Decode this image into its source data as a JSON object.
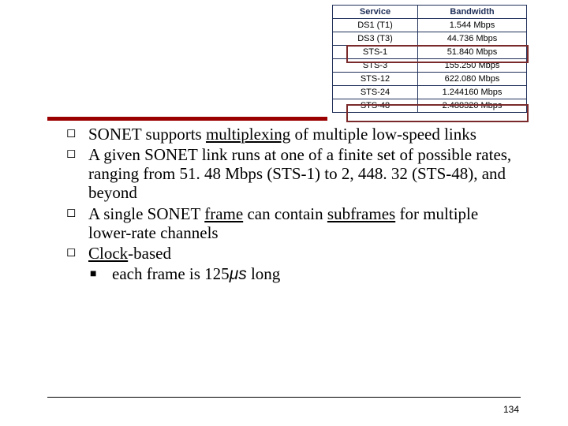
{
  "chart_data": {
    "type": "table",
    "columns": [
      "Service",
      "Bandwidth"
    ],
    "rows": [
      [
        "DS1 (T1)",
        "1.544 Mbps"
      ],
      [
        "DS3 (T3)",
        "44.736 Mbps"
      ],
      [
        "STS-1",
        "51.840 Mbps"
      ],
      [
        "STS-3",
        "155.250 Mbps"
      ],
      [
        "STS-12",
        "622.080 Mbps"
      ],
      [
        "STS-24",
        "1.244160 Mbps"
      ],
      [
        "STS-48",
        "2.488320 Mbps"
      ]
    ],
    "highlighted_rows": [
      2,
      6
    ]
  },
  "table": {
    "h1": "Service",
    "h2": "Bandwidth",
    "r0c0": "DS1 (T1)",
    "r0c1": "1.544 Mbps",
    "r1c0": "DS3 (T3)",
    "r1c1": "44.736 Mbps",
    "r2c0": "STS-1",
    "r2c1": "51.840 Mbps",
    "r3c0": "STS-3",
    "r3c1": "155.250 Mbps",
    "r4c0": "STS-12",
    "r4c1": "622.080 Mbps",
    "r5c0": "STS-24",
    "r5c1": "1.244160 Mbps",
    "r6c0": "STS-48",
    "r6c1": "2.488320 Mbps"
  },
  "bul": {
    "b1a": "SONET supports ",
    "b1u": "multiplexing",
    "b1b": " of multiple low-speed links",
    "b2": "A given SONET link runs at one of a finite set of possible rates, ranging from 51. 48 Mbps (STS-1) to 2, 448. 32 (STS-48), and beyond",
    "b3a": "A single SONET ",
    "b3u1": "frame",
    "b3b": " can contain ",
    "b3u2": "subframes",
    "b3c": " for multiple lower-rate channels",
    "b4u": "Clock",
    "b4a": "-based",
    "s1a": "each frame is 125",
    "s1mu": "μs",
    "s1b": " long"
  },
  "page": "134"
}
